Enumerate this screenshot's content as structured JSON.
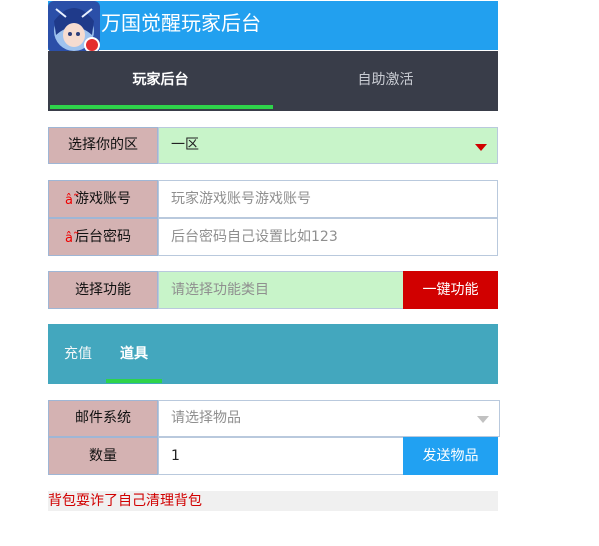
{
  "header": {
    "title": "万国觉醒玩家后台"
  },
  "tabs": [
    {
      "label": "玩家后台",
      "active": true
    },
    {
      "label": "自助激活",
      "active": false
    }
  ],
  "server": {
    "label": "选择你的区",
    "value": "一区"
  },
  "account": {
    "required_mark": "â˜",
    "label": "游戏账号",
    "placeholder": "玩家游戏账号游戏账号"
  },
  "password": {
    "required_mark": "â˜",
    "label": "后台密码",
    "placeholder": "后台密码自己设置比如123"
  },
  "function": {
    "label": "选择功能",
    "placeholder": "请选择功能类目",
    "button": "一键功能"
  },
  "subtabs": [
    {
      "label": "充值",
      "active": false
    },
    {
      "label": "道具",
      "active": true
    }
  ],
  "mail": {
    "label": "邮件系统",
    "placeholder": "请选择物品"
  },
  "quantity": {
    "label": "数量",
    "value": "1",
    "button": "发送物品"
  },
  "notice": "背包耍诈了自己清理背包",
  "colors": {
    "header": "#22a0ef",
    "tabs_bg": "#393d49",
    "accent_green": "#2ed34a",
    "danger": "#d10000",
    "teal_bar": "#43a7be"
  }
}
